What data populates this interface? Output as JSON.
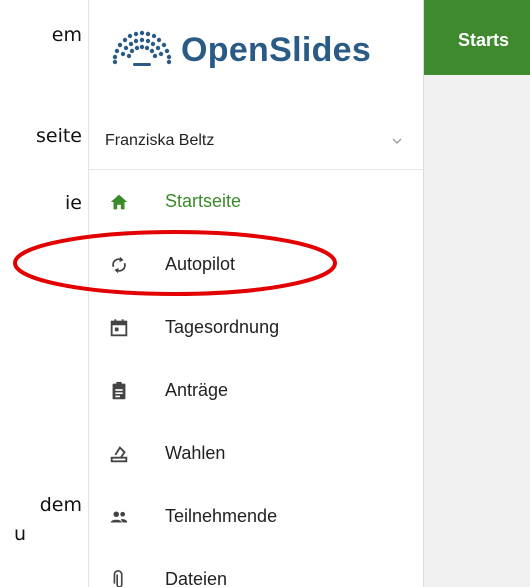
{
  "doc": {
    "lines": [
      "em",
      "seite",
      "ie",
      "dem",
      "u"
    ]
  },
  "app": {
    "brand": "OpenSlides",
    "brand_color": "#2a5b86",
    "accent_color": "#3f8a2e"
  },
  "user": {
    "name": "Franziska Beltz",
    "menu_icon": "chevron-down-icon"
  },
  "nav": {
    "items": [
      {
        "label": "Startseite",
        "icon": "home-icon",
        "active": true
      },
      {
        "label": "Autopilot",
        "icon": "sync-icon",
        "active": false,
        "highlighted": true
      },
      {
        "label": "Tagesordnung",
        "icon": "calendar-icon",
        "active": false
      },
      {
        "label": "Anträge",
        "icon": "clipboard-icon",
        "active": false
      },
      {
        "label": "Wahlen",
        "icon": "ballot-icon",
        "active": false
      },
      {
        "label": "Teilnehmende",
        "icon": "people-icon",
        "active": false
      },
      {
        "label": "Dateien",
        "icon": "paperclip-icon",
        "active": false
      }
    ]
  },
  "header": {
    "title": "Starts"
  }
}
